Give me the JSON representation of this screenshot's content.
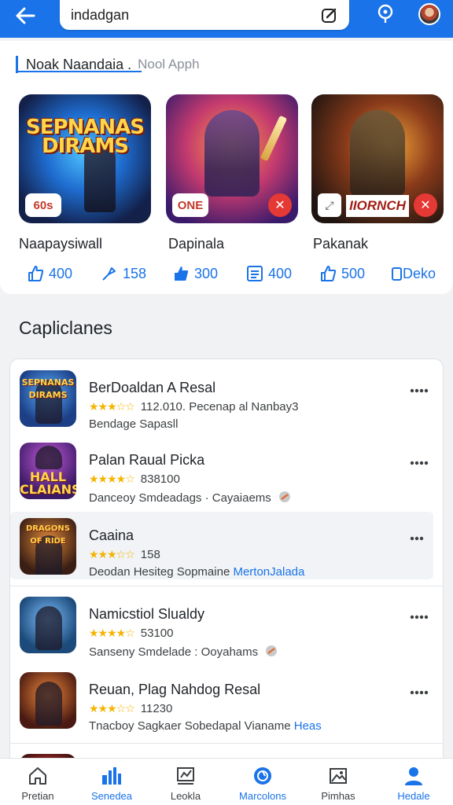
{
  "search": {
    "value": "indadgan"
  },
  "tabs": {
    "active": "Noak Naandaia .",
    "other": "Nool Apph"
  },
  "featured": [
    {
      "name": "Naapaysiwall",
      "art_title": "SEPNANAS DIRAMS",
      "badge": "60s",
      "corner": ""
    },
    {
      "name": "Dapinala",
      "art_title": "",
      "badge": "ONE",
      "corner": "✕"
    },
    {
      "name": "Pakanak",
      "art_title": "",
      "badge": "IIORNCH",
      "corner": "✕"
    }
  ],
  "stats": [
    {
      "icon": "thumbs-up-icon",
      "value": "400"
    },
    {
      "icon": "share-icon",
      "value": "158"
    },
    {
      "icon": "thumbs-up-filled-icon",
      "value": "300"
    },
    {
      "icon": "list-icon",
      "value": "400"
    },
    {
      "icon": "thumbs-up-icon",
      "value": "500"
    },
    {
      "icon": "link-icon",
      "value": "Deko"
    }
  ],
  "section_title": "Capliclanes",
  "apps": [
    {
      "name": "BerDoaldan A Resal",
      "stars": "★★★☆☆",
      "meta": "112.010. Pecenap al Nanbay3",
      "sub": "Bendage Sapasll",
      "sub_link": "",
      "icon_title": "SEPNANAS DIRAMS"
    },
    {
      "name": "Palan Raual Picka",
      "stars": "★★★★☆",
      "meta": "838100",
      "sub": "Danceoy Smdeadags · Cayaiaems",
      "sub_link": "",
      "icon_title": "HALL CLAIANS"
    },
    {
      "name": "Caaina",
      "stars": "★★★☆☆",
      "meta": "158",
      "sub": "Deodan Hesiteg Sopmaine",
      "sub_link": "MertonJalada",
      "icon_title": "DRAGONS OF RIDE"
    },
    {
      "name": "Namicstiol Slualdy",
      "stars": "★★★★☆",
      "meta": "53100",
      "sub": "Sanseny Smdelade : Ooyahams",
      "sub_link": "",
      "icon_title": ""
    },
    {
      "name": "Reuan, Plag Nahdog Resal",
      "stars": "★★★☆☆",
      "meta": "11230",
      "sub": "Tnacboy Sagkaer Sobedapal Vianame",
      "sub_link": "Heas",
      "icon_title": ""
    }
  ],
  "bottom_nav": [
    {
      "label": "Pretian",
      "icon": "home-icon",
      "active": false
    },
    {
      "label": "Senedea",
      "icon": "apps-icon",
      "active": true
    },
    {
      "label": "Leokla",
      "icon": "chart-icon",
      "active": false
    },
    {
      "label": "Marcolons",
      "icon": "globe-icon",
      "active": true
    },
    {
      "label": "Pimhas",
      "icon": "image-icon",
      "active": false
    },
    {
      "label": "Hedale",
      "icon": "person-icon",
      "active": true
    }
  ],
  "colors": {
    "accent": "#1a73e8",
    "star": "#f4b400",
    "badge_red": "#e53935"
  }
}
